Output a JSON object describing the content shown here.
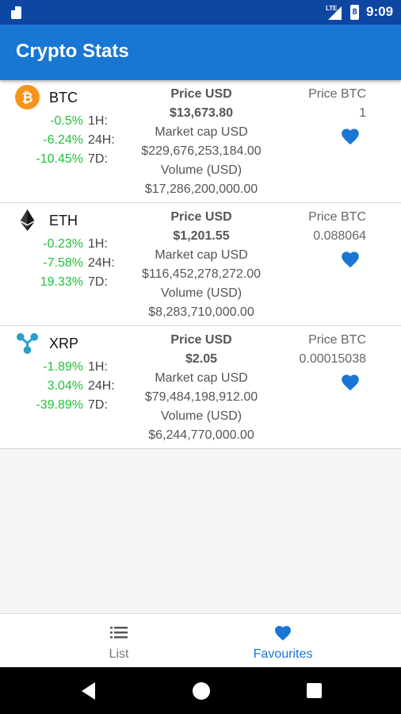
{
  "status_bar": {
    "network": "LTE",
    "battery": "8",
    "time": "9:09"
  },
  "app_bar": {
    "title": "Crypto Stats"
  },
  "colors": {
    "primary": "#1976d2",
    "status": "#0d47a1",
    "positive": "#1fc23a"
  },
  "coins": [
    {
      "icon": "bitcoin-icon",
      "symbol": "BTC",
      "changes": [
        {
          "value": "-0.5%",
          "label": "1H:"
        },
        {
          "value": "-6.24%",
          "label": "24H:"
        },
        {
          "value": "-10.45%",
          "label": "7D:"
        }
      ],
      "price_usd_label": "Price USD",
      "price_usd": "$13,673.80",
      "market_cap_label": "Market cap USD",
      "market_cap": "$229,676,253,184.00",
      "volume_label": "Volume (USD)",
      "volume": "$17,286,200,000.00",
      "price_btc_label": "Price BTC",
      "price_btc": "1"
    },
    {
      "icon": "ethereum-icon",
      "symbol": "ETH",
      "changes": [
        {
          "value": "-0.23%",
          "label": "1H:"
        },
        {
          "value": "-7.58%",
          "label": "24H:"
        },
        {
          "value": "19.33%",
          "label": "7D:"
        }
      ],
      "price_usd_label": "Price USD",
      "price_usd": "$1,201.55",
      "market_cap_label": "Market cap USD",
      "market_cap": "$116,452,278,272.00",
      "volume_label": "Volume (USD)",
      "volume": "$8,283,710,000.00",
      "price_btc_label": "Price BTC",
      "price_btc": "0.088064"
    },
    {
      "icon": "ripple-icon",
      "symbol": "XRP",
      "changes": [
        {
          "value": "-1.89%",
          "label": "1H:"
        },
        {
          "value": "3.04%",
          "label": "24H:"
        },
        {
          "value": "-39.89%",
          "label": "7D:"
        }
      ],
      "price_usd_label": "Price USD",
      "price_usd": "$2.05",
      "market_cap_label": "Market cap USD",
      "market_cap": "$79,484,198,912.00",
      "volume_label": "Volume (USD)",
      "volume": "$6,244,770,000.00",
      "price_btc_label": "Price BTC",
      "price_btc": "0.00015038"
    }
  ],
  "bottom_nav": {
    "list_label": "List",
    "favourites_label": "Favourites",
    "active": "favourites"
  }
}
